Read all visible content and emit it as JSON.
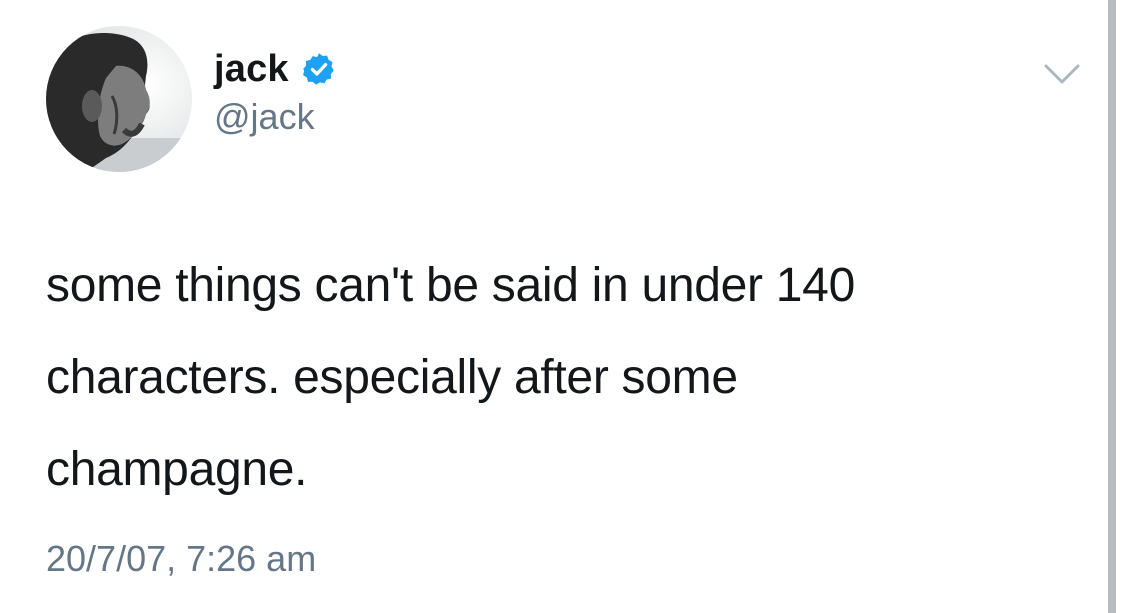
{
  "tweet": {
    "author": {
      "display_name": "jack",
      "handle": "@jack",
      "verified": true
    },
    "text": "some things can't be said in under 140\ncharacters.  especially after some\nchampagne.",
    "timestamp": "20/7/07, 7:26 am"
  },
  "icons": {
    "verified": "verified-badge-icon",
    "menu": "chevron-down-icon"
  },
  "colors": {
    "verified": "#1da1f2",
    "secondary_text": "#657786",
    "primary_text": "#14171a"
  }
}
